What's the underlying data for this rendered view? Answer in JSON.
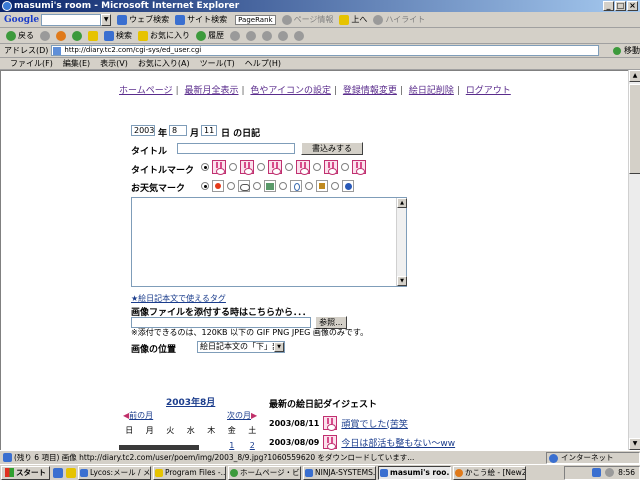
{
  "window": {
    "title": "masumi's room - Microsoft Internet Explorer",
    "controls": [
      "_",
      "□",
      "×"
    ]
  },
  "googlebar": {
    "logo": "Google",
    "web_search": "ウェブ検索",
    "site_search": "サイト検索",
    "pagerank": "PageRank",
    "page_info": "ページ情報",
    "up": "上へ",
    "highlight": "ハイライト"
  },
  "navbar": {
    "back": "戻る",
    "search": "検索",
    "favorites": "お気に入り",
    "history": "履歴"
  },
  "address": {
    "label": "アドレス(D)",
    "url": "http://diary.tc2.com/cgi-sys/ed_user.cgi",
    "go": "移動"
  },
  "menu": [
    "ファイル(F)",
    "編集(E)",
    "表示(V)",
    "お気に入り(A)",
    "ツール(T)",
    "ヘルプ(H)"
  ],
  "page": {
    "nav_links": [
      "ホームページ",
      "最新月全表示",
      "色やアイコンの設定",
      "登録情報変更",
      "絵日記削除",
      "ログアウト"
    ],
    "date": {
      "year": "2003",
      "year_label": "年",
      "month": "8",
      "month_label": "月",
      "day": "11",
      "day_label": "日 の日記"
    },
    "title_label": "タイトル",
    "submit_label": "書込みする",
    "title_mark_label": "タイトルマーク",
    "weather_label": "お天気マーク",
    "tags_link": "★絵日記本文で使えるタグ",
    "attach_label": "画像ファイルを添付する時はこちらから．．．",
    "browse_label": "参照...",
    "attach_note": "※添付できるのは、120KB 以下の GIF PNG JPEG 画像のみです。",
    "position_label": "画像の位置",
    "position_value": "絵日記本文の「下」部"
  },
  "calendar": {
    "title": "2003年8月",
    "prev": "前の月",
    "next": "次の月",
    "weekdays": [
      "日",
      "月",
      "火",
      "水",
      "木",
      "金",
      "土"
    ],
    "first_row": [
      "1",
      "2"
    ]
  },
  "digest": {
    "title": "最新の絵日記ダイジェスト",
    "entries": [
      {
        "date": "2003/08/11",
        "text": "頑賞でした(苦笑"
      },
      {
        "date": "2003/08/09",
        "text": "今日は部活も整もない～ww"
      }
    ]
  },
  "status": {
    "message": "(残り 6 項目) 画像 http://diary.tc2.com/user/poem/img/2003_8/9.jpg?1060559620 をダウンロードしています...",
    "zone": "インターネット"
  },
  "taskbar": {
    "start": "スタート",
    "tasks": [
      "Lycos:メール / メ...",
      "Program Files -...",
      "ホームページ・ビル...",
      "NINJA-SYSTEMS...",
      "masumi's roo...",
      "かこう絵 - [New2]"
    ],
    "active_index": 4,
    "clock": "8:56"
  }
}
